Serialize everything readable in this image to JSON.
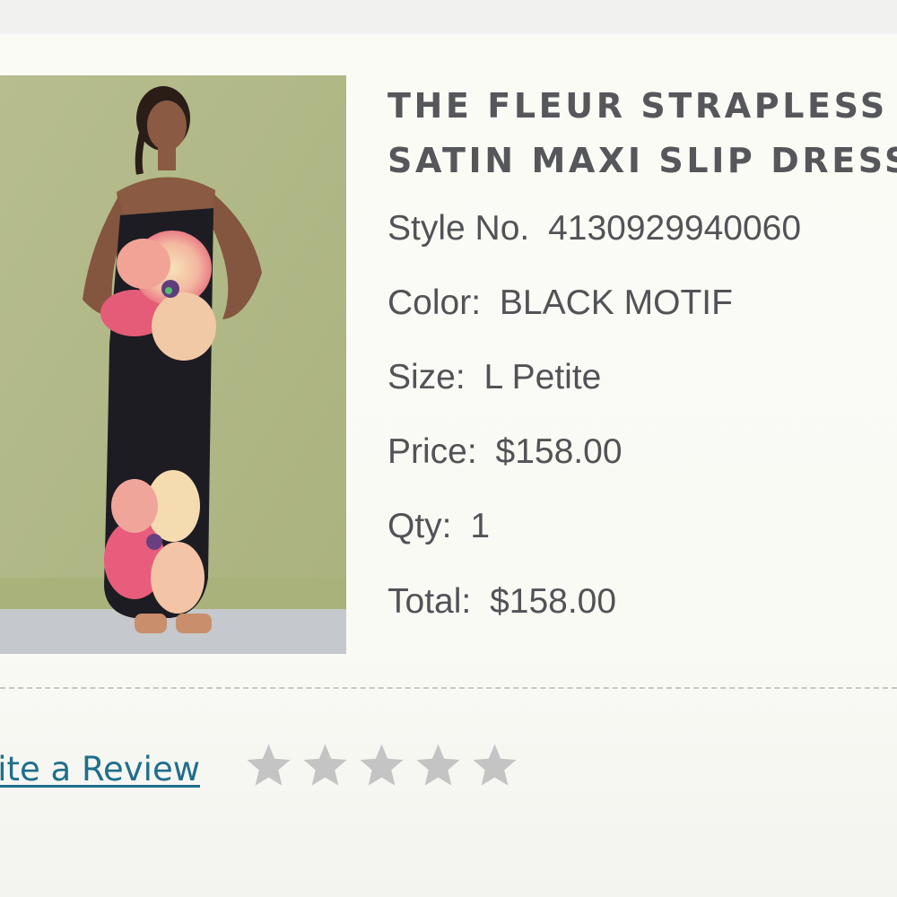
{
  "product": {
    "title_line1": "THE FLEUR STRAPLESS",
    "title_line2": "SATIN MAXI SLIP DRESS",
    "style_label": "Style No.",
    "style_value": "4130929940060",
    "color_label": "Color:",
    "color_value": "BLACK MOTIF",
    "size_label": "Size:",
    "size_value": "L Petite",
    "price_label": "Price:",
    "price_value": "$158.00",
    "qty_label": "Qty:",
    "qty_value": "1",
    "total_label": "Total:",
    "total_value": "$158.00",
    "image_icon": "product-photo"
  },
  "review": {
    "link_label": "rite a Review",
    "star_count": 5,
    "rating": 0,
    "star_icon": "star-icon",
    "star_color": "#c4c4c4"
  },
  "colors": {
    "text": "#515357",
    "link": "#1f6f8c",
    "divider": "#c8c9c4"
  }
}
